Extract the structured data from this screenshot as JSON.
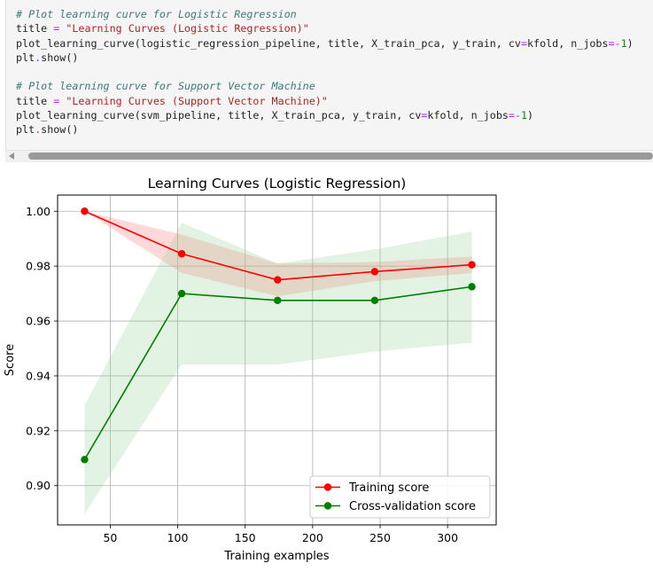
{
  "code_cell": {
    "lines": [
      [
        {
          "t": "# Plot learning curve for Logistic Regression",
          "c": "cmt"
        }
      ],
      [
        {
          "t": "title "
        },
        {
          "t": "=",
          "c": "op"
        },
        {
          "t": " "
        },
        {
          "t": "\"Learning Curves (Logistic Regression)\"",
          "c": "str"
        }
      ],
      [
        {
          "t": "plot_learning_curve(logistic_regression_pipeline, title, X_train_pca, y_train, cv"
        },
        {
          "t": "=",
          "c": "op"
        },
        {
          "t": "kfold, n_jobs"
        },
        {
          "t": "=-",
          "c": "op"
        },
        {
          "t": "1",
          "c": "num"
        },
        {
          "t": ")"
        }
      ],
      [
        {
          "t": "plt"
        },
        {
          "t": ".",
          "c": "op"
        },
        {
          "t": "show()"
        }
      ],
      [
        {
          "t": ""
        }
      ],
      [
        {
          "t": "# Plot learning curve for Support Vector Machine",
          "c": "cmt"
        }
      ],
      [
        {
          "t": "title "
        },
        {
          "t": "=",
          "c": "op"
        },
        {
          "t": " "
        },
        {
          "t": "\"Learning Curves (Support Vector Machine)\"",
          "c": "str"
        }
      ],
      [
        {
          "t": "plot_learning_curve(svm_pipeline, title, X_train_pca, y_train, cv"
        },
        {
          "t": "=",
          "c": "op"
        },
        {
          "t": "kfold, n_jobs"
        },
        {
          "t": "=-",
          "c": "op"
        },
        {
          "t": "1",
          "c": "num"
        },
        {
          "t": ")"
        }
      ],
      [
        {
          "t": "plt"
        },
        {
          "t": ".",
          "c": "op"
        },
        {
          "t": "show()"
        }
      ]
    ]
  },
  "colors": {
    "training": "#ff0000",
    "cv": "#008000",
    "training_band": "#ff8080",
    "cv_band": "#8fcf8f",
    "grid": "#b0b0b0"
  },
  "chart_data": {
    "type": "line",
    "title": "Learning Curves (Logistic Regression)",
    "xlabel": "Training examples",
    "ylabel": "Score",
    "xlim": [
      11,
      336
    ],
    "ylim": [
      0.8857,
      1.0059
    ],
    "xticks": [
      50,
      100,
      150,
      200,
      250,
      300
    ],
    "yticks": [
      0.9,
      0.92,
      0.94,
      0.96,
      0.98,
      1.0
    ],
    "ytick_labels": [
      "0.90",
      "0.92",
      "0.94",
      "0.96",
      "0.98",
      "1.00"
    ],
    "grid": true,
    "legend_position": "lower-right",
    "x": [
      31,
      103,
      174,
      246,
      318
    ],
    "series": [
      {
        "name": "Training score",
        "values": [
          1.0,
          0.9845,
          0.975,
          0.978,
          0.9805
        ],
        "lower": [
          1.0,
          0.9775,
          0.969,
          0.9745,
          0.9775
        ],
        "upper": [
          1.0,
          0.9915,
          0.981,
          0.9815,
          0.9835
        ]
      },
      {
        "name": "Cross-validation score",
        "values": [
          0.9095,
          0.97,
          0.9675,
          0.9675,
          0.9725
        ],
        "lower": [
          0.8897,
          0.9441,
          0.9441,
          0.9489,
          0.9521
        ],
        "upper": [
          0.9293,
          0.9959,
          0.9809,
          0.9861,
          0.9926
        ]
      }
    ]
  }
}
